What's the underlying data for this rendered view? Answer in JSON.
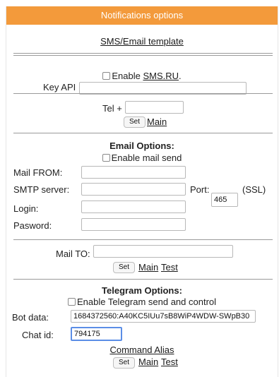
{
  "header": {
    "title": "Notifications options"
  },
  "template_link": "SMS/Email template",
  "sms": {
    "enable_label": "Enable ",
    "enable_link": "SMS.RU",
    "enable_suffix": ".",
    "key_api_label": "Key API",
    "key_api_value": "",
    "tel_label": "Tel +",
    "tel_value": "",
    "set_button": "Set",
    "main_link": "Main"
  },
  "email": {
    "title": "Email Options:",
    "enable_label": "Enable mail send",
    "mail_from_label": "Mail FROM:",
    "mail_from_value": "",
    "smtp_label": "SMTP server:",
    "smtp_value": "",
    "port_label": "Port:",
    "port_value": "465",
    "ssl_label": "(SSL)",
    "login_label": "Login:",
    "login_value": "",
    "password_label": "Pasword:",
    "password_value": "",
    "mail_to_label": "Mail TO:",
    "mail_to_value": "",
    "set_button": "Set",
    "main_link": "Main",
    "test_link": "Test"
  },
  "telegram": {
    "title": "Telegram Options:",
    "enable_label": "Enable Telegram send and control",
    "bot_label": "Bot data:",
    "bot_value": "1684372560:A40KC5IUu7sB8WiP4WDW-SWpB30",
    "chat_label": "Chat id:",
    "chat_value": "794175",
    "command_link": "Command Alias",
    "set_button": "Set",
    "main_link": "Main",
    "test_link": "Test"
  }
}
